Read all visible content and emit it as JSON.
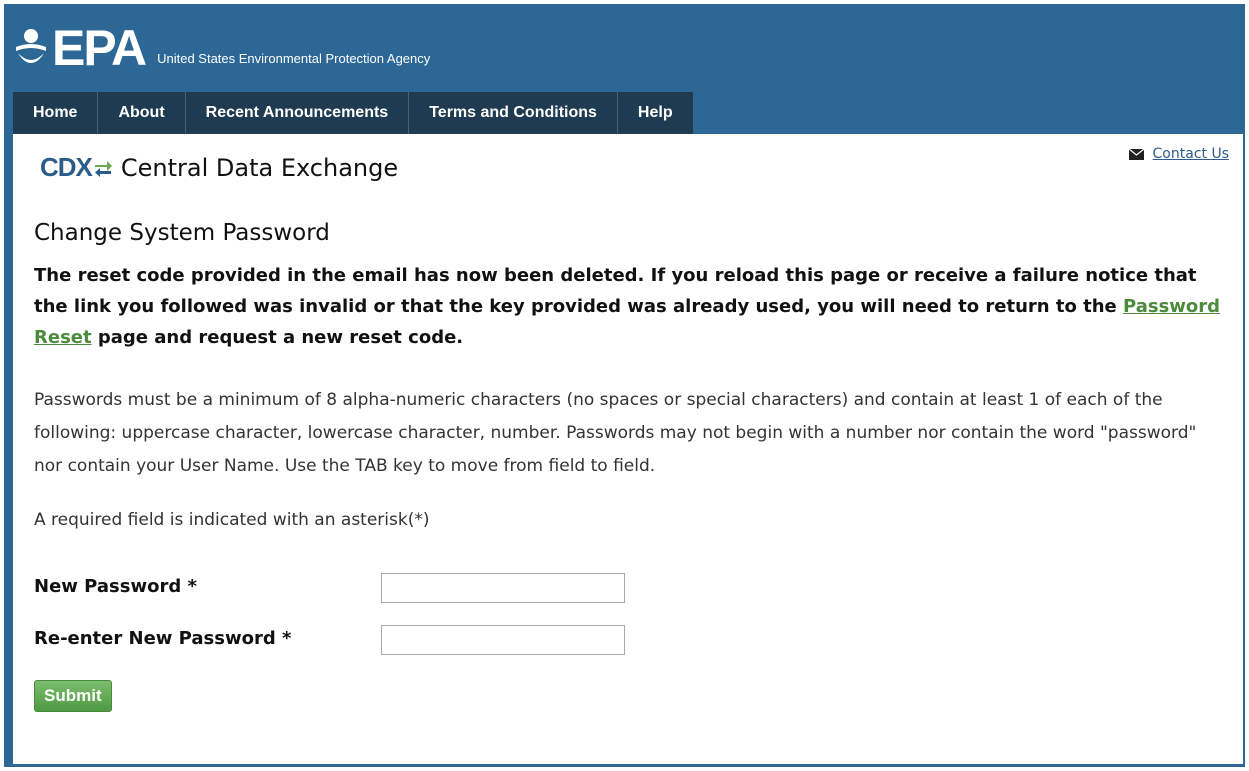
{
  "header": {
    "logo_text": "EPA",
    "agency_name": "United States Environmental Protection Agency"
  },
  "nav": {
    "items": [
      {
        "label": "Home"
      },
      {
        "label": "About"
      },
      {
        "label": "Recent Announcements"
      },
      {
        "label": "Terms and Conditions"
      },
      {
        "label": "Help"
      }
    ]
  },
  "app": {
    "logo_text": "CDX",
    "title": "Central Data Exchange",
    "contact_label": "Contact Us"
  },
  "page": {
    "title": "Change System Password",
    "notice_before": "The reset code provided in the email has now been deleted. If you reload this page or receive a failure notice that the link you followed was invalid or that the key provided was already used, you will need to return to the ",
    "notice_link": "Password Reset",
    "notice_after": " page and request a new reset code.",
    "rules": "Passwords must be a minimum of 8 alpha-numeric characters (no spaces or special characters) and contain at least 1 of each of the following: uppercase character, lowercase character, number. Passwords may not begin with a number nor contain the word \"password\" nor contain your User Name. Use the TAB key to move from field to field.",
    "required_note": "A required field is indicated with an asterisk(*)"
  },
  "form": {
    "new_password_label": "New Password *",
    "new_password_value": "",
    "reenter_password_label": "Re-enter New Password *",
    "reenter_password_value": "",
    "submit_label": "Submit"
  },
  "colors": {
    "header_blue": "#2d6796",
    "nav_dark": "#1f3b52",
    "link_green": "#4c8a3c",
    "submit_green": "#5ea851"
  }
}
